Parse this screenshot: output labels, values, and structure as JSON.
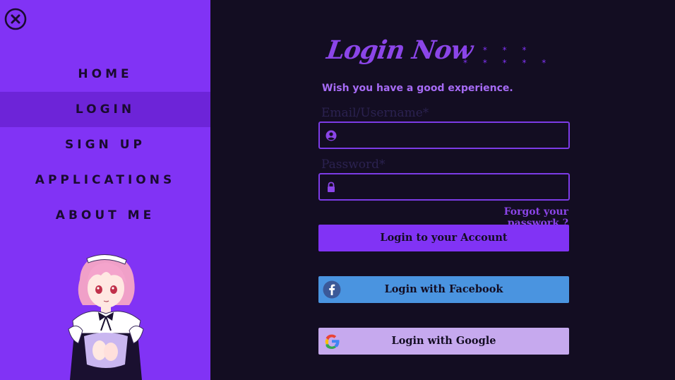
{
  "sidebar": {
    "nav": [
      {
        "label": "HOME"
      },
      {
        "label": "LOGIN"
      },
      {
        "label": "SIGN UP"
      },
      {
        "label": "APPLICATIONS"
      },
      {
        "label": "ABOUT ME"
      }
    ],
    "active_index": 1
  },
  "login": {
    "title": "Login Now",
    "stars_row1": "* * * *",
    "stars_row2": "* * * * *",
    "subtitle": "Wish you have a good experience.",
    "email_label": "Email/Username*",
    "email_value": "",
    "password_label": "Password*",
    "password_value": "",
    "forgot": "Forgot your passwork ?",
    "submit_label": "Login to your Account",
    "facebook_label": "Login with Facebook",
    "google_label": "Login with Google"
  },
  "colors": {
    "sidebar_bg": "#8133f5",
    "sidebar_active": "#6d24d8",
    "page_bg": "#130d22",
    "accent": "#8b45e8",
    "facebook": "#4a94e0",
    "google_btn": "#c6a9ee"
  },
  "icons": [
    "close-icon",
    "user-icon",
    "lock-icon",
    "facebook-icon",
    "google-icon"
  ]
}
